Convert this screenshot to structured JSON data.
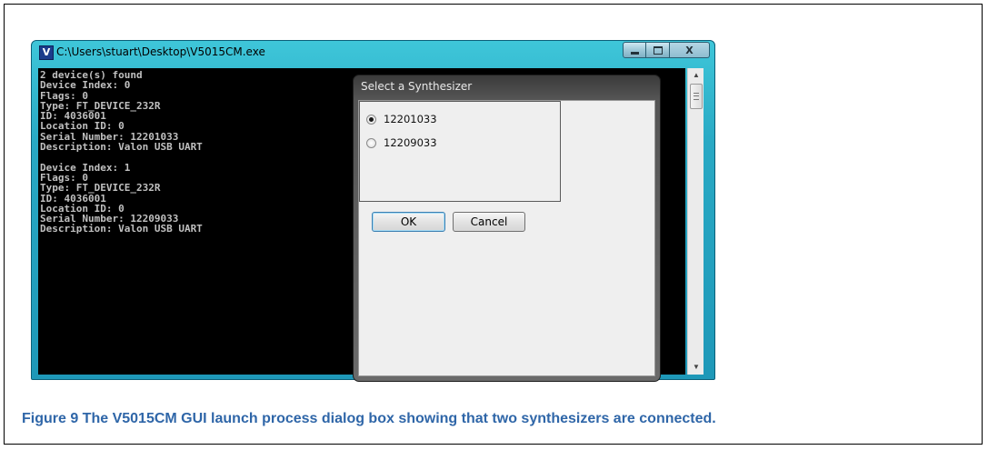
{
  "console_window": {
    "title": "C:\\Users\\stuart\\Desktop\\V5015CM.exe",
    "icon_letter": "V",
    "output_lines": [
      "2 device(s) found",
      "Device Index: 0",
      "Flags: 0",
      "Type: FT_DEVICE_232R",
      "ID: 4036001",
      "Location ID: 0",
      "Serial Number: 12201033",
      "Description: Valon USB UART",
      "",
      "Device Index: 1",
      "Flags: 0",
      "Type: FT_DEVICE_232R",
      "ID: 4036001",
      "Location ID: 0",
      "Serial Number: 12209033",
      "Description: Valon USB UART"
    ],
    "close_glyph": "X"
  },
  "dialog": {
    "title": "Select a Synthesizer",
    "options": [
      {
        "label": "12201033",
        "selected": true
      },
      {
        "label": "12209033",
        "selected": false
      }
    ],
    "ok_label": "OK",
    "cancel_label": "Cancel"
  },
  "caption": "Figure 9  The V5015CM GUI launch process dialog box showing that two synthesizers are connected."
}
